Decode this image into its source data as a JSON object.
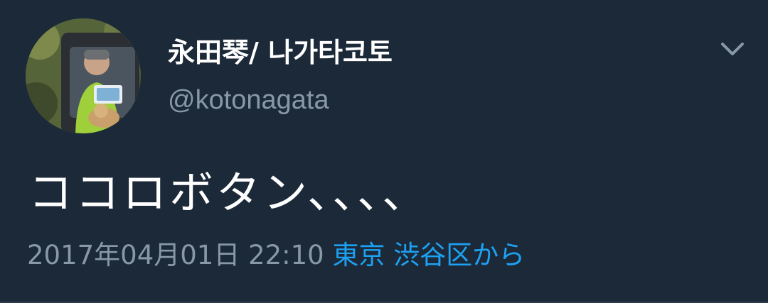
{
  "tweet": {
    "display_name": "永田琴/ 나가타코토",
    "handle": "@kotonagata",
    "text": "ココロボタン、、、、",
    "timestamp": "2017年04月01日 22:10",
    "location": "東京 渋谷区",
    "source_suffix": "から",
    "menu_icon": "chevron-down-icon",
    "avatar_icon": "profile-photo"
  },
  "colors": {
    "background": "#1c2938",
    "primary_text": "#ffffff",
    "secondary_text": "#8899a6",
    "link": "#1da1f2"
  }
}
